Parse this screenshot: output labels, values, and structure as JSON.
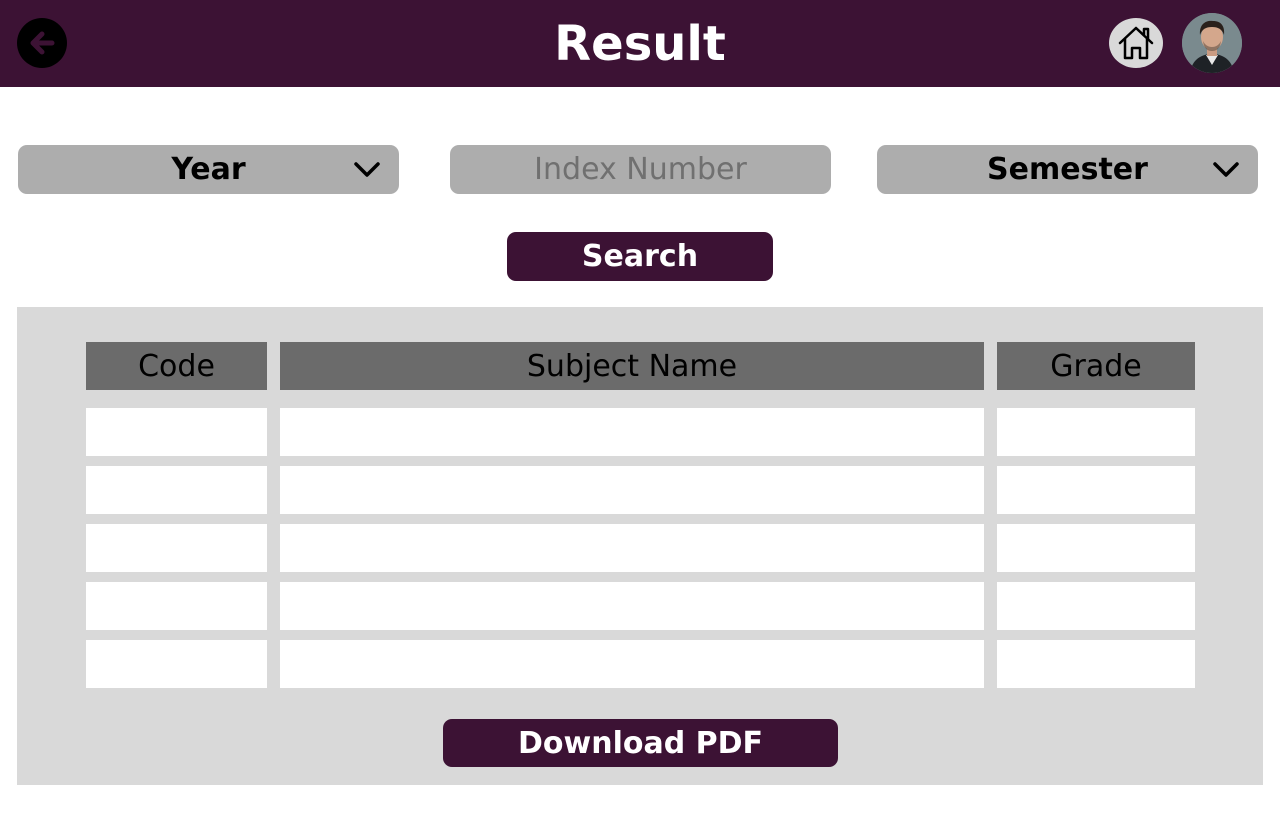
{
  "header": {
    "title": "Result",
    "back_icon": "arrow-left-icon",
    "home_icon": "home-icon",
    "avatar_icon": "user-avatar",
    "brand_color": "#3c1234"
  },
  "filters": {
    "year": {
      "label": "Year",
      "icon": "chevron-down-icon"
    },
    "index_number": {
      "placeholder": "Index Number",
      "value": ""
    },
    "semester": {
      "label": "Semester",
      "icon": "chevron-down-icon"
    }
  },
  "search_button": {
    "label": "Search"
  },
  "results_table": {
    "headers": {
      "code": "Code",
      "subject_name": "Subject Name",
      "grade": "Grade"
    },
    "rows": [
      {
        "code": "",
        "subject_name": "",
        "grade": ""
      },
      {
        "code": "",
        "subject_name": "",
        "grade": ""
      },
      {
        "code": "",
        "subject_name": "",
        "grade": ""
      },
      {
        "code": "",
        "subject_name": "",
        "grade": ""
      },
      {
        "code": "",
        "subject_name": "",
        "grade": ""
      }
    ]
  },
  "download_button": {
    "label": "Download PDF"
  }
}
